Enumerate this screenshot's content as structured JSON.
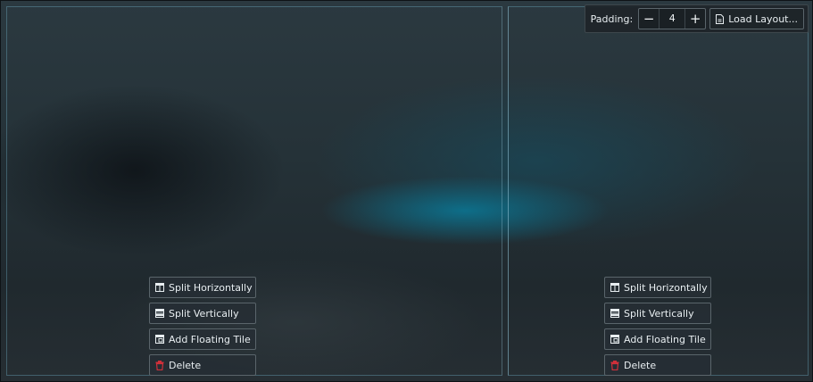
{
  "toolbar": {
    "padding_label": "Padding:",
    "minus": "−",
    "padding_value": "4",
    "plus": "+",
    "load_layout": "Load Layout..."
  },
  "menus": {
    "left": {
      "split_horizontally": "Split Horizontally",
      "split_vertically": "Split Vertically",
      "add_floating_tile": "Add Floating Tile",
      "delete": "Delete"
    },
    "right": {
      "split_horizontally": "Split Horizontally",
      "split_vertically": "Split Vertically",
      "add_floating_tile": "Add Floating Tile",
      "delete": "Delete"
    }
  },
  "icons": {
    "split_horizontally": "columns-icon",
    "split_vertically": "rows-icon",
    "add_floating_tile": "floating-window-icon",
    "delete": "trash-icon",
    "load_layout": "file-icon"
  },
  "colors": {
    "delete_icon": "#d0303a",
    "tile_border": "#78bed7"
  }
}
